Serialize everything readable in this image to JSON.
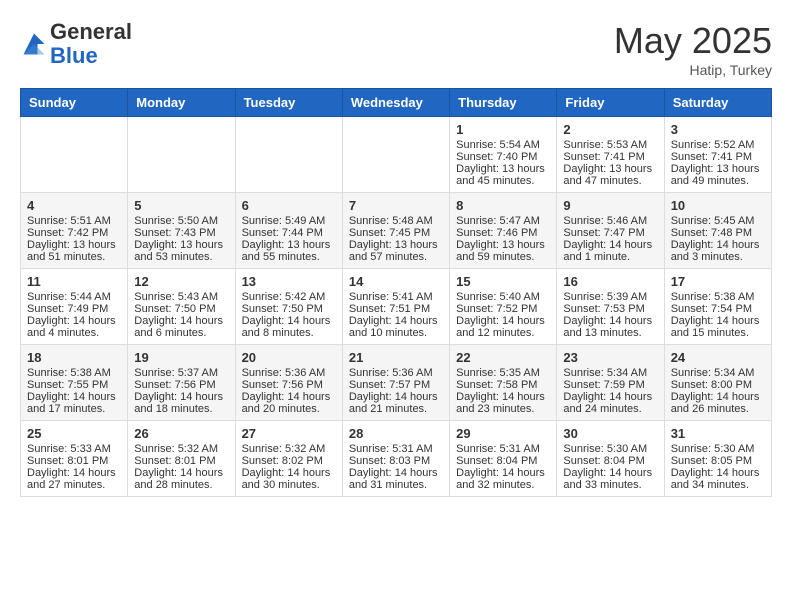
{
  "header": {
    "logo_general": "General",
    "logo_blue": "Blue",
    "month_year": "May 2025",
    "location": "Hatip, Turkey"
  },
  "weekdays": [
    "Sunday",
    "Monday",
    "Tuesday",
    "Wednesday",
    "Thursday",
    "Friday",
    "Saturday"
  ],
  "weeks": [
    [
      null,
      null,
      null,
      null,
      {
        "day": "1",
        "sunrise": "Sunrise: 5:54 AM",
        "sunset": "Sunset: 7:40 PM",
        "daylight": "Daylight: 13 hours and 45 minutes."
      },
      {
        "day": "2",
        "sunrise": "Sunrise: 5:53 AM",
        "sunset": "Sunset: 7:41 PM",
        "daylight": "Daylight: 13 hours and 47 minutes."
      },
      {
        "day": "3",
        "sunrise": "Sunrise: 5:52 AM",
        "sunset": "Sunset: 7:41 PM",
        "daylight": "Daylight: 13 hours and 49 minutes."
      }
    ],
    [
      {
        "day": "4",
        "sunrise": "Sunrise: 5:51 AM",
        "sunset": "Sunset: 7:42 PM",
        "daylight": "Daylight: 13 hours and 51 minutes."
      },
      {
        "day": "5",
        "sunrise": "Sunrise: 5:50 AM",
        "sunset": "Sunset: 7:43 PM",
        "daylight": "Daylight: 13 hours and 53 minutes."
      },
      {
        "day": "6",
        "sunrise": "Sunrise: 5:49 AM",
        "sunset": "Sunset: 7:44 PM",
        "daylight": "Daylight: 13 hours and 55 minutes."
      },
      {
        "day": "7",
        "sunrise": "Sunrise: 5:48 AM",
        "sunset": "Sunset: 7:45 PM",
        "daylight": "Daylight: 13 hours and 57 minutes."
      },
      {
        "day": "8",
        "sunrise": "Sunrise: 5:47 AM",
        "sunset": "Sunset: 7:46 PM",
        "daylight": "Daylight: 13 hours and 59 minutes."
      },
      {
        "day": "9",
        "sunrise": "Sunrise: 5:46 AM",
        "sunset": "Sunset: 7:47 PM",
        "daylight": "Daylight: 14 hours and 1 minute."
      },
      {
        "day": "10",
        "sunrise": "Sunrise: 5:45 AM",
        "sunset": "Sunset: 7:48 PM",
        "daylight": "Daylight: 14 hours and 3 minutes."
      }
    ],
    [
      {
        "day": "11",
        "sunrise": "Sunrise: 5:44 AM",
        "sunset": "Sunset: 7:49 PM",
        "daylight": "Daylight: 14 hours and 4 minutes."
      },
      {
        "day": "12",
        "sunrise": "Sunrise: 5:43 AM",
        "sunset": "Sunset: 7:50 PM",
        "daylight": "Daylight: 14 hours and 6 minutes."
      },
      {
        "day": "13",
        "sunrise": "Sunrise: 5:42 AM",
        "sunset": "Sunset: 7:50 PM",
        "daylight": "Daylight: 14 hours and 8 minutes."
      },
      {
        "day": "14",
        "sunrise": "Sunrise: 5:41 AM",
        "sunset": "Sunset: 7:51 PM",
        "daylight": "Daylight: 14 hours and 10 minutes."
      },
      {
        "day": "15",
        "sunrise": "Sunrise: 5:40 AM",
        "sunset": "Sunset: 7:52 PM",
        "daylight": "Daylight: 14 hours and 12 minutes."
      },
      {
        "day": "16",
        "sunrise": "Sunrise: 5:39 AM",
        "sunset": "Sunset: 7:53 PM",
        "daylight": "Daylight: 14 hours and 13 minutes."
      },
      {
        "day": "17",
        "sunrise": "Sunrise: 5:38 AM",
        "sunset": "Sunset: 7:54 PM",
        "daylight": "Daylight: 14 hours and 15 minutes."
      }
    ],
    [
      {
        "day": "18",
        "sunrise": "Sunrise: 5:38 AM",
        "sunset": "Sunset: 7:55 PM",
        "daylight": "Daylight: 14 hours and 17 minutes."
      },
      {
        "day": "19",
        "sunrise": "Sunrise: 5:37 AM",
        "sunset": "Sunset: 7:56 PM",
        "daylight": "Daylight: 14 hours and 18 minutes."
      },
      {
        "day": "20",
        "sunrise": "Sunrise: 5:36 AM",
        "sunset": "Sunset: 7:56 PM",
        "daylight": "Daylight: 14 hours and 20 minutes."
      },
      {
        "day": "21",
        "sunrise": "Sunrise: 5:36 AM",
        "sunset": "Sunset: 7:57 PM",
        "daylight": "Daylight: 14 hours and 21 minutes."
      },
      {
        "day": "22",
        "sunrise": "Sunrise: 5:35 AM",
        "sunset": "Sunset: 7:58 PM",
        "daylight": "Daylight: 14 hours and 23 minutes."
      },
      {
        "day": "23",
        "sunrise": "Sunrise: 5:34 AM",
        "sunset": "Sunset: 7:59 PM",
        "daylight": "Daylight: 14 hours and 24 minutes."
      },
      {
        "day": "24",
        "sunrise": "Sunrise: 5:34 AM",
        "sunset": "Sunset: 8:00 PM",
        "daylight": "Daylight: 14 hours and 26 minutes."
      }
    ],
    [
      {
        "day": "25",
        "sunrise": "Sunrise: 5:33 AM",
        "sunset": "Sunset: 8:01 PM",
        "daylight": "Daylight: 14 hours and 27 minutes."
      },
      {
        "day": "26",
        "sunrise": "Sunrise: 5:32 AM",
        "sunset": "Sunset: 8:01 PM",
        "daylight": "Daylight: 14 hours and 28 minutes."
      },
      {
        "day": "27",
        "sunrise": "Sunrise: 5:32 AM",
        "sunset": "Sunset: 8:02 PM",
        "daylight": "Daylight: 14 hours and 30 minutes."
      },
      {
        "day": "28",
        "sunrise": "Sunrise: 5:31 AM",
        "sunset": "Sunset: 8:03 PM",
        "daylight": "Daylight: 14 hours and 31 minutes."
      },
      {
        "day": "29",
        "sunrise": "Sunrise: 5:31 AM",
        "sunset": "Sunset: 8:04 PM",
        "daylight": "Daylight: 14 hours and 32 minutes."
      },
      {
        "day": "30",
        "sunrise": "Sunrise: 5:30 AM",
        "sunset": "Sunset: 8:04 PM",
        "daylight": "Daylight: 14 hours and 33 minutes."
      },
      {
        "day": "31",
        "sunrise": "Sunrise: 5:30 AM",
        "sunset": "Sunset: 8:05 PM",
        "daylight": "Daylight: 14 hours and 34 minutes."
      }
    ]
  ]
}
